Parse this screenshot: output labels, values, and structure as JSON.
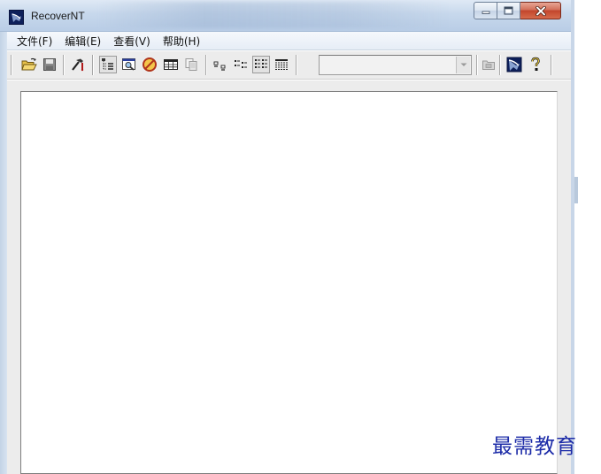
{
  "window": {
    "title": "RecoverNT",
    "caption_buttons": {
      "minimize_icon": "minimize-icon",
      "maximize_icon": "maximize-icon",
      "close_icon": "close-icon"
    }
  },
  "menu": {
    "items": [
      "文件(F)",
      "编辑(E)",
      "查看(V)",
      "帮助(H)"
    ]
  },
  "toolbar": {
    "combo_value": "",
    "icons": [
      "open-folder-icon",
      "save-icon",
      "tools-icon",
      "tree-view-icon",
      "find-icon",
      "stop-icon",
      "grid-icon",
      "copy-icon",
      "large-icons-icon",
      "small-icons-icon",
      "list-icon",
      "details-icon",
      "folder-up-icon",
      "about-icon",
      "help-icon"
    ]
  },
  "watermark": {
    "text": "最需教育"
  },
  "colors": {
    "accent": "#1d2ca8",
    "close_button": "#c2452c"
  }
}
